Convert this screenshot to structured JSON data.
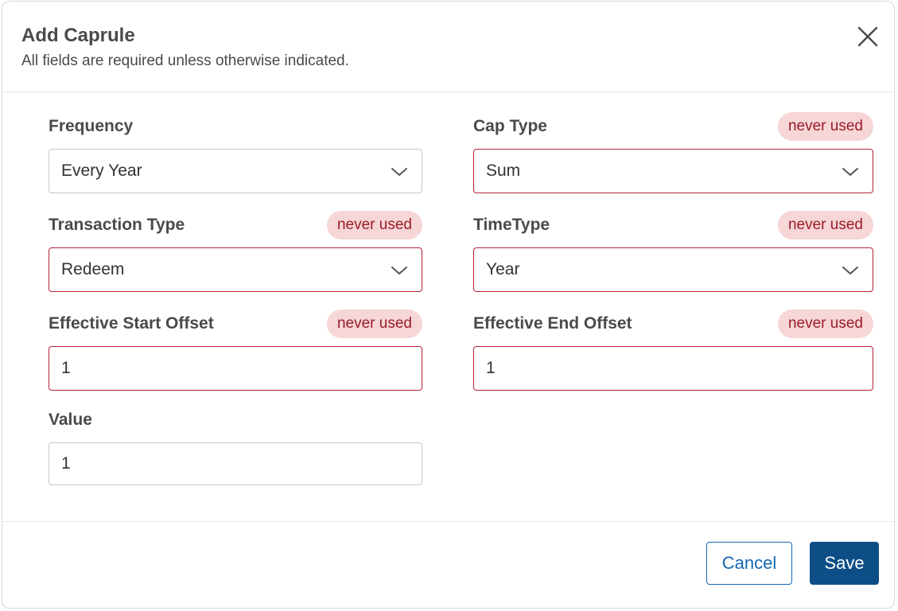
{
  "dialog": {
    "title": "Add Caprule",
    "subtitle": "All fields are required unless otherwise indicated."
  },
  "fields": {
    "frequency": {
      "label": "Frequency",
      "value": "Every Year"
    },
    "cap_type": {
      "label": "Cap Type",
      "value": "Sum",
      "badge": "never used"
    },
    "transaction_type": {
      "label": "Transaction Type",
      "value": "Redeem",
      "badge": "never used"
    },
    "time_type": {
      "label": "TimeType",
      "value": "Year",
      "badge": "never used"
    },
    "effective_start_offset": {
      "label": "Effective Start Offset",
      "value": "1",
      "badge": "never used"
    },
    "effective_end_offset": {
      "label": "Effective End Offset",
      "value": "1",
      "badge": "never used"
    },
    "value": {
      "label": "Value",
      "value": "1"
    }
  },
  "footer": {
    "cancel_label": "Cancel",
    "save_label": "Save"
  },
  "colors": {
    "badge_bg": "#f6d6d6",
    "badge_text": "#9b1c2a",
    "error_border": "#b8233a",
    "primary": "#0d4e86",
    "link": "#1468b4"
  },
  "icons": {
    "close": "close-icon",
    "dropdown": "chevron-down-icon"
  }
}
